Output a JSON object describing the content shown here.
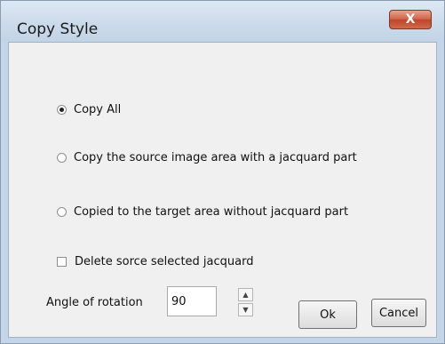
{
  "window": {
    "title": "Copy Style",
    "close_symbol": "X"
  },
  "options": [
    {
      "label": "Copy All",
      "selected": true
    },
    {
      "label": "Copy the source image area with a jacquard part",
      "selected": false
    },
    {
      "label": "Copied to the target area without jacquard part",
      "selected": false
    }
  ],
  "delete_checkbox": {
    "label": "Delete sorce selected jacquard",
    "checked": false
  },
  "angle": {
    "label": "Angle of rotation",
    "value": "90"
  },
  "buttons": {
    "ok": "Ok",
    "cancel": "Cancel"
  },
  "colors": {
    "title_bar": "#c8d8ea",
    "close_button": "#c9543a",
    "dialog_background": "#f0f0f0"
  }
}
